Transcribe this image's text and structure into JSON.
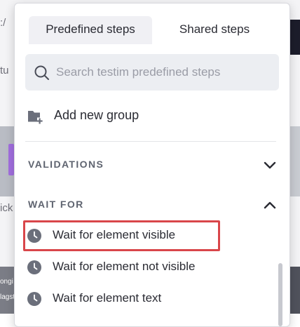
{
  "background": {
    "fragments": {
      "url_prefix": ":/",
      "setup": "tu",
      "click": "ick",
      "flags": "ongi",
      "flagst": "lagst"
    }
  },
  "popover": {
    "tabs": [
      {
        "label": "Predefined steps",
        "active": true
      },
      {
        "label": "Shared steps",
        "active": false
      }
    ],
    "search": {
      "placeholder": "Search testim predefined steps",
      "value": ""
    },
    "add_group_label": "Add new group",
    "sections": [
      {
        "title": "VALIDATIONS",
        "expanded": false,
        "chevron": "chevron-down-icon"
      },
      {
        "title": "WAIT FOR",
        "expanded": true,
        "chevron": "chevron-up-icon"
      }
    ],
    "wait_for_items": [
      {
        "label": "Wait for element visible",
        "highlighted": true
      },
      {
        "label": "Wait for element not visible",
        "highlighted": false
      },
      {
        "label": "Wait for element text",
        "highlighted": false
      }
    ]
  },
  "colors": {
    "highlight_border": "#d9464a",
    "tab_active_bg": "#f0f0f4",
    "search_bg": "#eceef2",
    "icon_grey": "#6b6f7b"
  }
}
